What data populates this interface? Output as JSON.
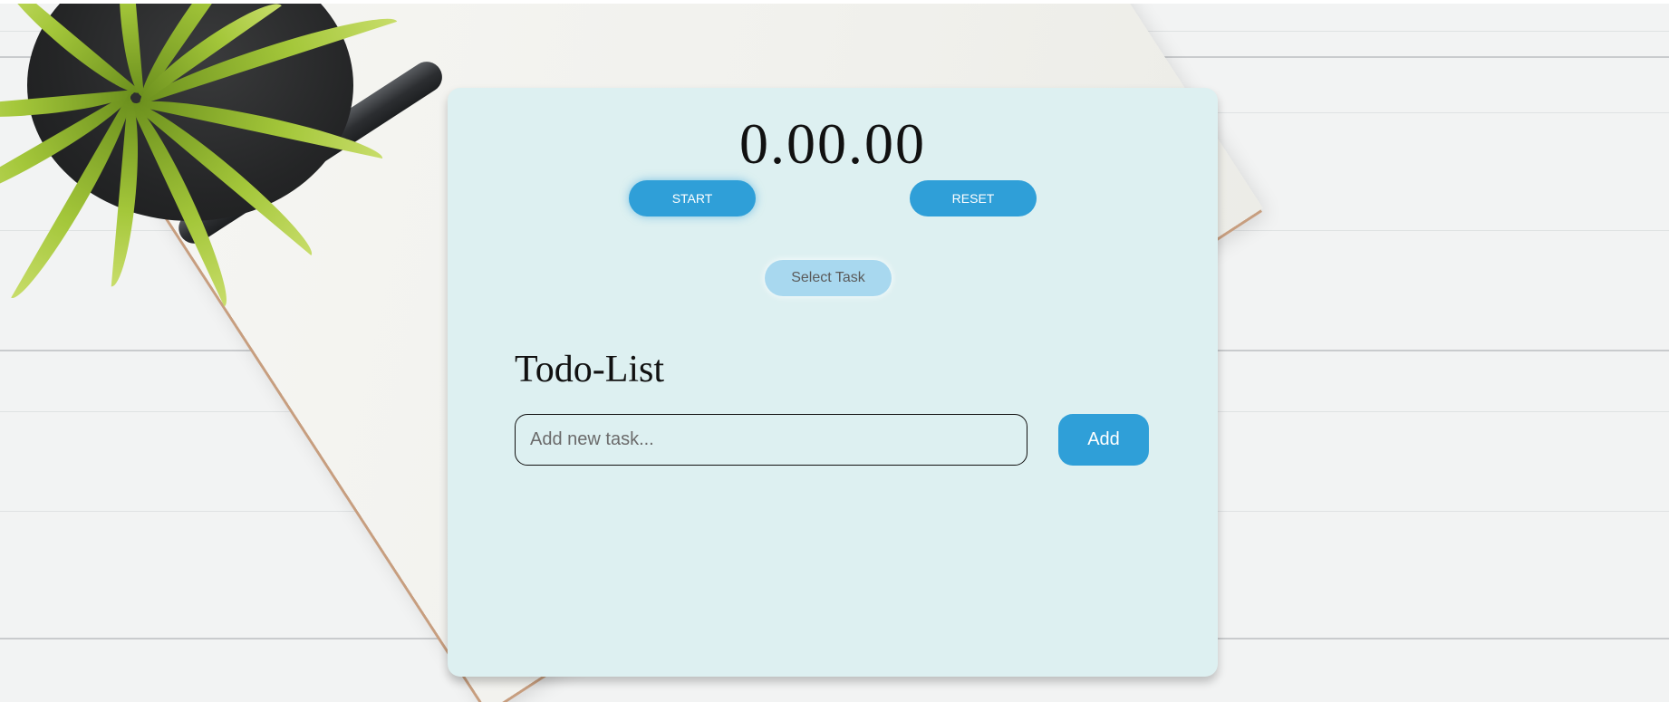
{
  "timer": {
    "display": "0.00.00",
    "start_label": "START",
    "reset_label": "RESET"
  },
  "task_selector": {
    "label": "Select Task"
  },
  "todo": {
    "title": "Todo-List",
    "input_placeholder": "Add new task...",
    "input_value": "",
    "add_label": "Add",
    "items": []
  },
  "colors": {
    "card_background": "#ddf0f1",
    "primary_button": "#2f9fd8",
    "secondary_button": "#a8d8ef",
    "text": "#111111"
  },
  "background": {
    "scene": "desk-with-plant-pen-notebook"
  }
}
